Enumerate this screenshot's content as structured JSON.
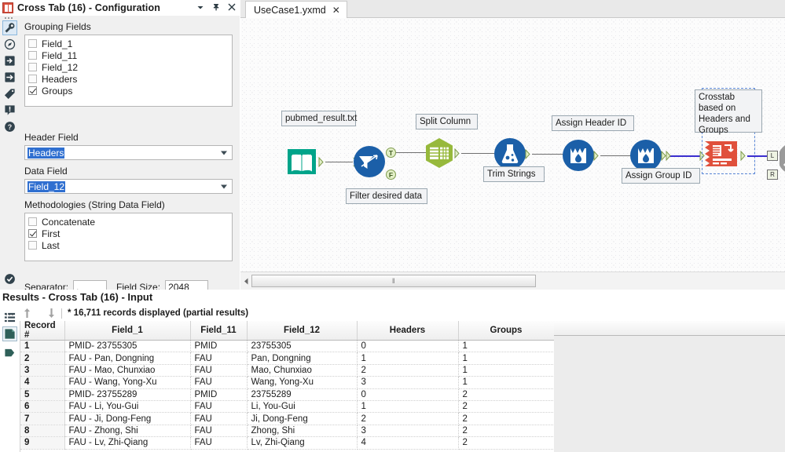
{
  "config_panel": {
    "icon": "crosstab-icon",
    "title": "Cross Tab (16) - Configuration",
    "titlebar_buttons": [
      {
        "name": "dropdown-icon",
        "label": "▾"
      },
      {
        "name": "pin-icon",
        "label": "⚐"
      },
      {
        "name": "close-icon",
        "label": "✕"
      }
    ],
    "rail_icons": [
      {
        "name": "wrench-icon",
        "selected": true
      },
      {
        "name": "compass-icon",
        "selected": false
      },
      {
        "name": "input-arrow-icon",
        "selected": false
      },
      {
        "name": "output-arrow-icon",
        "selected": false
      },
      {
        "name": "tag-icon",
        "selected": false
      },
      {
        "name": "annotation-icon",
        "selected": false
      },
      {
        "name": "help-icon",
        "selected": false
      },
      {
        "name": "valid-check-icon",
        "selected": false
      }
    ],
    "grouping_fields_label": "Grouping Fields",
    "grouping_fields": [
      {
        "label": "Field_1",
        "checked": false
      },
      {
        "label": "Field_11",
        "checked": false
      },
      {
        "label": "Field_12",
        "checked": false
      },
      {
        "label": "Headers",
        "checked": false
      },
      {
        "label": "Groups",
        "checked": true
      }
    ],
    "header_field_label": "Header Field",
    "header_field_value": "Headers",
    "data_field_label": "Data Field",
    "data_field_value": "Field_12",
    "methodologies_label": "Methodologies (String Data Field)",
    "methodologies": [
      {
        "label": "Concatenate",
        "checked": false
      },
      {
        "label": "First",
        "checked": true
      },
      {
        "label": "Last",
        "checked": false
      }
    ],
    "separator_label": "Separator:",
    "separator_value": ",",
    "field_size_label": "Field Size:",
    "field_size_value": "2048"
  },
  "canvas": {
    "tab": {
      "label": "UseCase1.yxmd",
      "close": "✕"
    },
    "nodes": [
      {
        "name": "input-data-tool",
        "label": "pubmed_result.txt",
        "icon": "book-icon",
        "color": "#00a48a"
      },
      {
        "name": "filter-tool",
        "label": "Filter desired data",
        "icon": "filter-icon",
        "color": "#1b5fa8",
        "ports": [
          "T",
          "F"
        ]
      },
      {
        "name": "split-column-tool",
        "label": "Split Column",
        "icon": "text-to-columns-icon",
        "color": "#97b93c"
      },
      {
        "name": "trim-strings-tool",
        "label": "Trim Strings",
        "icon": "formula-icon",
        "color": "#1b5fa8"
      },
      {
        "name": "assign-header-id-tool",
        "label": "Assign Header ID",
        "icon": "record-id-icon",
        "color": "#1b5fa8"
      },
      {
        "name": "assign-group-id-tool",
        "label": "Assign Group ID",
        "icon": "record-id-icon",
        "color": "#1b5fa8"
      },
      {
        "name": "crosstab-tool",
        "label": "Crosstab based on Headers and Groups",
        "icon": "crosstab-icon",
        "color": "#e0503c",
        "selected": true
      },
      {
        "name": "join-tool",
        "label": "",
        "icon": "join-icon",
        "color": "#8a8a8a",
        "ports": [
          "L",
          "R"
        ]
      }
    ],
    "hscroll_grip": "‖"
  },
  "results": {
    "title": "Results - Cross Tab (16) - Input",
    "rail_icons": [
      {
        "name": "list-view-icon",
        "selected": false
      },
      {
        "name": "data-view-icon",
        "selected": true
      },
      {
        "name": "profile-view-icon",
        "selected": false
      }
    ],
    "up_arrow": "↑",
    "down_arrow": "↓",
    "record_count": "* 16,711 records displayed (partial results)",
    "columns": [
      "Record #",
      "Field_1",
      "Field_11",
      "Field_12",
      "Headers",
      "Groups"
    ],
    "rows": [
      [
        "1",
        "PMID- 23755305",
        "PMID",
        "23755305",
        "0",
        "1"
      ],
      [
        "2",
        "FAU - Pan, Dongning",
        "FAU",
        "Pan, Dongning",
        "1",
        "1"
      ],
      [
        "3",
        "FAU - Mao, Chunxiao",
        "FAU",
        "Mao, Chunxiao",
        "2",
        "1"
      ],
      [
        "4",
        "FAU - Wang, Yong-Xu",
        "FAU",
        "Wang, Yong-Xu",
        "3",
        "1"
      ],
      [
        "5",
        "PMID- 23755289",
        "PMID",
        "23755289",
        "0",
        "2"
      ],
      [
        "6",
        "FAU - Li, You-Gui",
        "FAU",
        "Li, You-Gui",
        "1",
        "2"
      ],
      [
        "7",
        "FAU - Ji, Dong-Feng",
        "FAU",
        "Ji, Dong-Feng",
        "2",
        "2"
      ],
      [
        "8",
        "FAU - Zhong, Shi",
        "FAU",
        "Zhong, Shi",
        "3",
        "2"
      ],
      [
        "9",
        "FAU - Lv, Zhi-Qiang",
        "FAU",
        "Lv, Zhi-Qiang",
        "4",
        "2"
      ]
    ]
  },
  "colors": {
    "accent_blue": "#2f6fd0",
    "tool_green": "#00a48a",
    "tool_lime": "#97b93c",
    "tool_blue": "#1b5fa8",
    "tool_red": "#e0503c",
    "wire_blue": "#3b2fcf"
  }
}
